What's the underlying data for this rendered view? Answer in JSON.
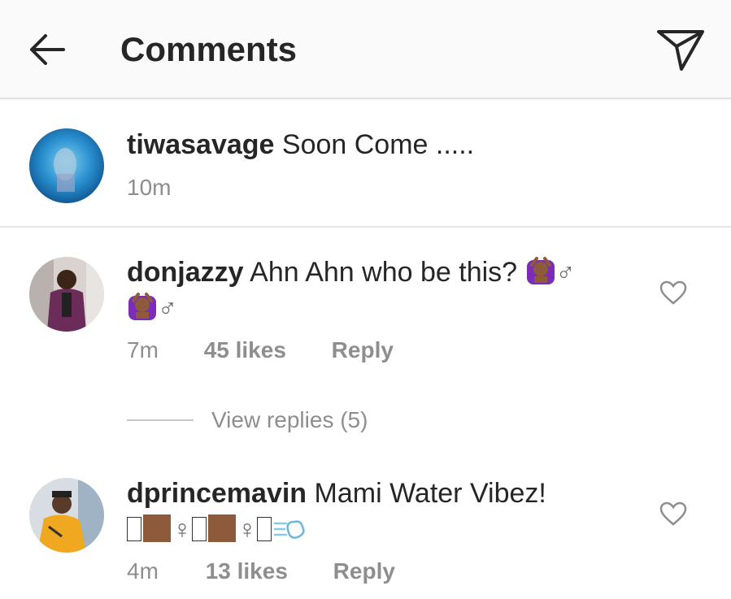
{
  "header": {
    "title": "Comments",
    "back_icon": "arrow-left-icon",
    "send_icon": "paper-plane-icon"
  },
  "caption": {
    "username": "tiwasavage",
    "text": "Soon Come .....",
    "time": "10m"
  },
  "comments": [
    {
      "username": "donjazzy",
      "text_line1": "Ahn Ahn who be this? ",
      "gender_symbol": "♂",
      "time": "7m",
      "likes": "45 likes",
      "reply": "Reply",
      "view_replies": "View replies (5)"
    },
    {
      "username": "dprincemavin",
      "text_line1": "Mami Water Vibez!",
      "female_symbol": "♀",
      "time": "4m",
      "likes": "13 likes",
      "reply": "Reply"
    }
  ],
  "colors": {
    "text": "#262626",
    "meta": "#8e8e8e",
    "header_bg": "#fafafa",
    "divider": "#e3e3e3"
  }
}
